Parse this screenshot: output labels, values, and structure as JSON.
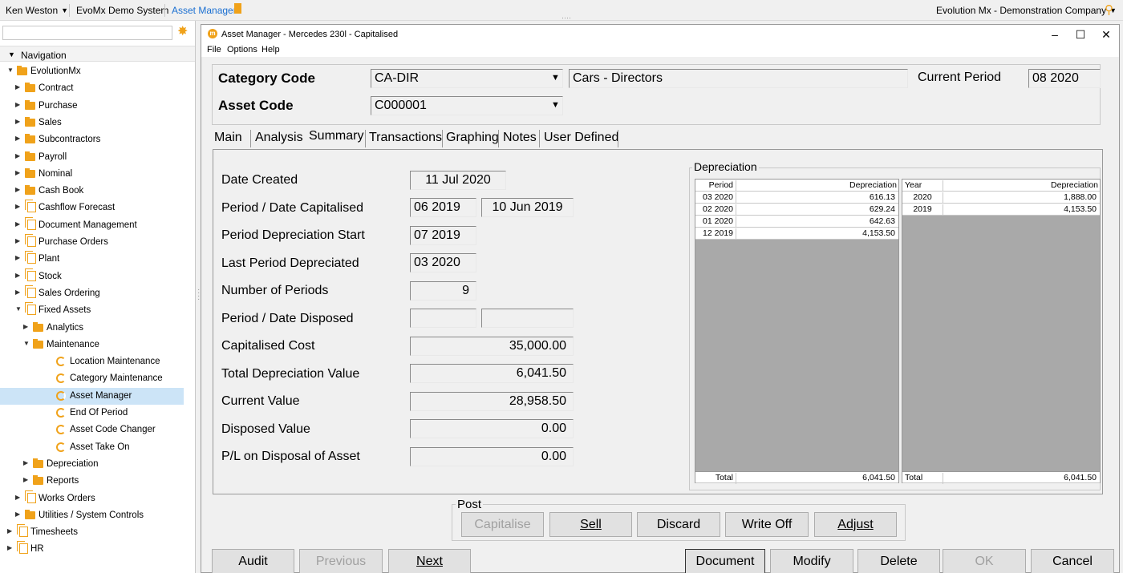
{
  "topbar": {
    "user": "Ken Weston",
    "system": "EvoMx Demo System",
    "module": "Asset Manager",
    "company": "Evolution Mx - Demonstration Company"
  },
  "nav": {
    "search_placeholder": "",
    "heading": "Navigation",
    "tree": [
      {
        "label": "EvolutionMx",
        "icon": "folder",
        "expanded": true
      },
      {
        "label": "Contract",
        "icon": "folder"
      },
      {
        "label": "Purchase",
        "icon": "folder"
      },
      {
        "label": "Sales",
        "icon": "folder"
      },
      {
        "label": "Subcontractors",
        "icon": "folder"
      },
      {
        "label": "Payroll",
        "icon": "folder"
      },
      {
        "label": "Nominal",
        "icon": "folder"
      },
      {
        "label": "Cash Book",
        "icon": "folder"
      },
      {
        "label": "Cashflow Forecast",
        "icon": "doc"
      },
      {
        "label": "Document Management",
        "icon": "doc"
      },
      {
        "label": "Purchase Orders",
        "icon": "doc"
      },
      {
        "label": "Plant",
        "icon": "doc"
      },
      {
        "label": "Stock",
        "icon": "doc"
      },
      {
        "label": "Sales Ordering",
        "icon": "doc"
      },
      {
        "label": "Fixed Assets",
        "icon": "doc",
        "expanded": true
      },
      {
        "label": "Analytics",
        "icon": "folder"
      },
      {
        "label": "Maintenance",
        "icon": "folder",
        "expanded": true
      },
      {
        "label": "Location Maintenance",
        "icon": "circle"
      },
      {
        "label": "Category Maintenance",
        "icon": "circle"
      },
      {
        "label": "Asset Manager",
        "icon": "circle",
        "selected": true
      },
      {
        "label": "End Of Period",
        "icon": "circle"
      },
      {
        "label": "Asset Code Changer",
        "icon": "circle"
      },
      {
        "label": "Asset Take On",
        "icon": "circle"
      },
      {
        "label": "Depreciation",
        "icon": "folder"
      },
      {
        "label": "Reports",
        "icon": "folder"
      },
      {
        "label": "Works Orders",
        "icon": "doc"
      },
      {
        "label": "Utilities / System Controls",
        "icon": "folder"
      },
      {
        "label": "Timesheets",
        "icon": "doc"
      },
      {
        "label": "HR",
        "icon": "doc"
      }
    ]
  },
  "window": {
    "title": "Asset Manager - Mercedes 230l - Capitalised",
    "menu": [
      "File",
      "Options",
      "Help"
    ]
  },
  "header": {
    "category_code_label": "Category Code",
    "category_code": "CA-DIR",
    "category_desc": "Cars - Directors",
    "current_period_label": "Current Period",
    "current_period": "08 2020",
    "asset_code_label": "Asset Code",
    "asset_code": "C000001"
  },
  "tabs": [
    "Main",
    "Analysis",
    "Summary",
    "Transactions",
    "Graphing",
    "Notes",
    "User Defined"
  ],
  "active_tab": "Summary",
  "summary": {
    "date_created_label": "Date Created",
    "date_created": "11 Jul 2020",
    "period_cap_label": "Period / Date Capitalised",
    "period_cap": "06 2019",
    "date_cap": "10 Jun 2019",
    "dep_start_label": "Period Depreciation Start",
    "dep_start": "07 2019",
    "last_dep_label": "Last Period Depreciated",
    "last_dep": "03 2020",
    "num_periods_label": "Number of Periods",
    "num_periods": "9",
    "disposed_label": "Period / Date Disposed",
    "period_disposed": "",
    "date_disposed": "",
    "cap_cost_label": "Capitalised Cost",
    "cap_cost": "35,000.00",
    "total_dep_label": "Total Depreciation Value",
    "total_dep": "6,041.50",
    "current_value_label": "Current Value",
    "current_value": "28,958.50",
    "disposed_value_label": "Disposed Value",
    "disposed_value": "0.00",
    "pl_label": "P/L on Disposal of Asset",
    "pl_value": "0.00"
  },
  "depreciation": {
    "title": "Depreciation",
    "period_grid": {
      "headers": [
        "Period",
        "Depreciation"
      ],
      "rows": [
        [
          "03 2020",
          "616.13"
        ],
        [
          "02 2020",
          "629.24"
        ],
        [
          "01 2020",
          "642.63"
        ],
        [
          "12 2019",
          "4,153.50"
        ]
      ],
      "total_label": "Total",
      "total": "6,041.50"
    },
    "year_grid": {
      "headers": [
        "Year",
        "Depreciation"
      ],
      "rows": [
        [
          "2020",
          "1,888.00"
        ],
        [
          "2019",
          "4,153.50"
        ]
      ],
      "total_label": "Total",
      "total": "6,041.50"
    }
  },
  "post": {
    "title": "Post",
    "capitalise": "Capitalise",
    "sell": "Sell",
    "discard": "Discard",
    "write_off": "Write Off",
    "adjust": "Adjust"
  },
  "footer": {
    "audit": "Audit",
    "previous": "Previous",
    "next": "Next",
    "document": "Document",
    "modify": "Modify",
    "delete": "Delete",
    "ok": "OK",
    "cancel": "Cancel"
  },
  "colors": {
    "accent": "#f0a21a",
    "link": "#1a6fd1",
    "selection": "#cce4f7",
    "grid_empty": "#a9a9a9"
  }
}
